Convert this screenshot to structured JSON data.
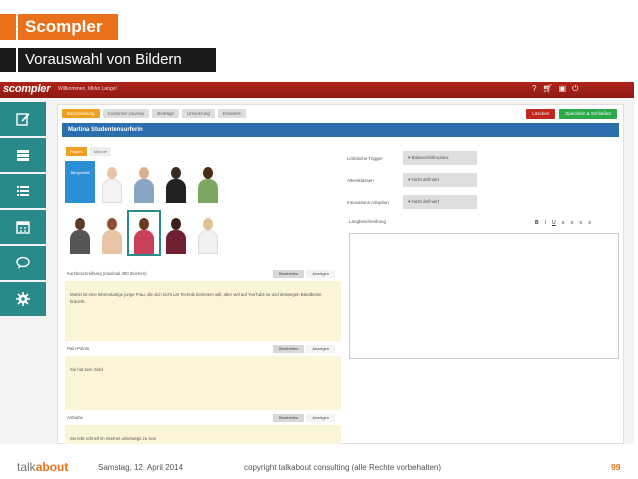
{
  "slide": {
    "title": "Scompler",
    "subtitle": "Vorauswahl von Bildern"
  },
  "app": {
    "brand": "scompler",
    "welcome": "Willkommen, Mirko Lange!",
    "top_icons": [
      "?",
      "cart-icon",
      "notification-icon",
      "power-icon"
    ]
  },
  "sidebar": {
    "items": [
      "edit-icon",
      "layers-icon",
      "list-icon",
      "calendar-icon",
      "chat-icon",
      "gear-icon"
    ]
  },
  "tabs": [
    "Beschreibung",
    "Customer Journey",
    "Beiträge",
    "Umsetzung",
    "Erweitert"
  ],
  "buttons": {
    "delete": "Löschen",
    "save_close": "Speichern & Schließen"
  },
  "persona": {
    "title": "Martina Studentensurferin"
  },
  "gender_tabs": [
    "Frauen",
    "Männer"
  ],
  "photo_overlay": "Bild gewählt",
  "fields": [
    {
      "label": "Kurzbeschreibung (maximal 300 Zeichen)",
      "edit": "Bearbeiten",
      "show": "Anzeigen",
      "text": "Martin ist eine lebenslustige junge Frau, die sich nicht um Technik kümmern will, aber viel auf YouTube ist und deswegen Bandbreite braucht."
    },
    {
      "label": "Pain-Points",
      "edit": "Bearbeiten",
      "show": "Anzeigen",
      "text": "Sie hat kein Geld"
    },
    {
      "label": "Antriebe",
      "edit": "Bearbeiten",
      "show": "Anzeigen",
      "text": "Sie lebt schnell im Internet unterwegs zu sein"
    }
  ],
  "selects": [
    {
      "label": "Limbische Trigger",
      "value": "Balance/Stimulanz"
    },
    {
      "label": "Altersklassen",
      "value": "Nicht definiert"
    },
    {
      "label": "Innovations Adoption",
      "value": "Nicht definiert"
    }
  ],
  "long_description": {
    "label": "Langbeschreibung",
    "toolbar": [
      "B",
      "I",
      "U",
      "≡",
      "≡",
      "≡",
      "≡"
    ]
  },
  "footer": {
    "logo_a": "talk",
    "logo_b": "about",
    "date": "Samstag, 12. April 2014",
    "copyright": "copyright talkabout consulting (alle Rechte vorbehalten)",
    "page": "99"
  }
}
